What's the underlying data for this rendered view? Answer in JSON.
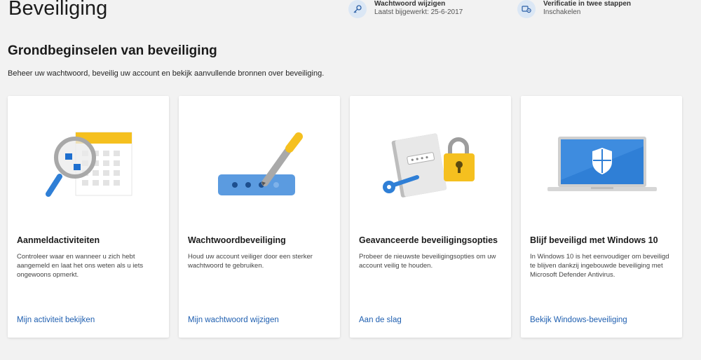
{
  "header": {
    "title": "Beveiliging",
    "quick_links": [
      {
        "title": "Wachtwoord wijzigen",
        "subtitle": "Laatst bijgewerkt: 25-6-2017",
        "icon": "key-icon"
      },
      {
        "title": "Verificatie in twee stappen",
        "subtitle": "Inschakelen",
        "icon": "two-step-icon"
      }
    ]
  },
  "section": {
    "title": "Grondbeginselen van beveiliging",
    "description": "Beheer uw wachtwoord, beveilig uw account en bekijk aanvullende bronnen over beveiliging."
  },
  "cards": [
    {
      "title": "Aanmeldactiviteiten",
      "description": "Controleer waar en wanneer u zich hebt aangemeld en laat het ons weten als u iets ongewoons opmerkt.",
      "link": "Mijn activiteit bekijken",
      "icon": "magnifier-calendar-icon"
    },
    {
      "title": "Wachtwoordbeveiliging",
      "description": "Houd uw account veiliger door een sterker wachtwoord te gebruiken.",
      "link": "Mijn wachtwoord wijzigen",
      "icon": "password-pen-icon"
    },
    {
      "title": "Geavanceerde beveiligingsopties",
      "description": "Probeer de nieuwste beveiligingsopties om uw account veilig te houden.",
      "link": "Aan de slag",
      "icon": "padlock-key-icon"
    },
    {
      "title": "Blijf beveiligd met Windows 10",
      "description": "In Windows 10 is het eenvoudiger om beveiligd te blijven dankzij ingebouwde beveiliging met Microsoft Defender Antivirus.",
      "link": "Bekijk Windows-beveiliging",
      "icon": "laptop-shield-icon"
    }
  ],
  "colors": {
    "background": "#f2f2f2",
    "card": "#ffffff",
    "link": "#1f5fb0",
    "accent_blue": "#2f7fd6",
    "accent_yellow": "#f5c01f"
  }
}
